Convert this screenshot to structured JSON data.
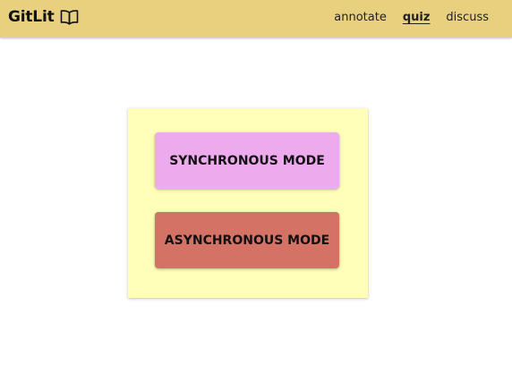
{
  "header": {
    "brand": "GitLit",
    "brand_icon": "open-book-icon",
    "nav": [
      {
        "label": "annotate",
        "active": false
      },
      {
        "label": "quiz",
        "active": true
      },
      {
        "label": "discuss",
        "active": false
      }
    ]
  },
  "main": {
    "modes": [
      {
        "label": "SYNCHRONOUS MODE",
        "color": "#edaaec"
      },
      {
        "label": "ASYNCHRONOUS MODE",
        "color": "#d47265"
      }
    ]
  },
  "colors": {
    "navbar": "#e8d07e",
    "card": "#ffffb9"
  }
}
